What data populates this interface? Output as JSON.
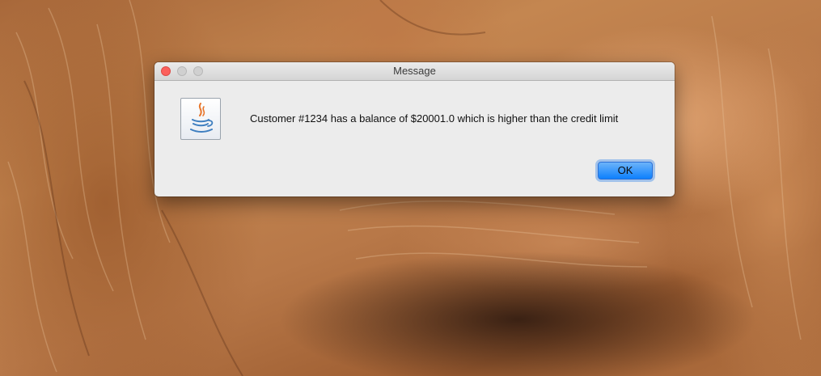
{
  "desktop": {
    "wallpaper": "lion-wallpaper"
  },
  "dialog": {
    "title": "Message",
    "icon": "java-coffee-cup-icon",
    "message": "Customer #1234 has a balance of $20001.0 which is higher than the credit limit",
    "ok_label": "OK"
  },
  "colors": {
    "close_button": "#fc605c",
    "ok_button": "#0d80fd",
    "dialog_background": "#ececec"
  }
}
